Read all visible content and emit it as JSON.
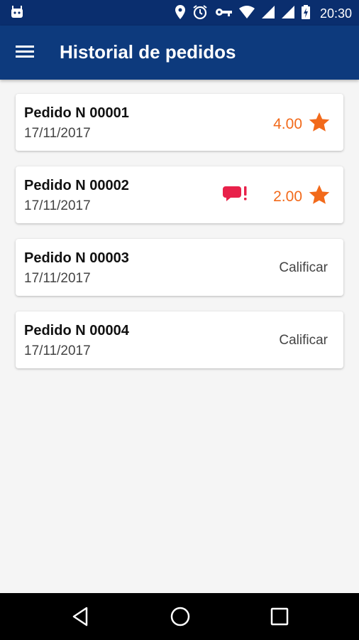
{
  "status_bar": {
    "time": "20:30",
    "icons": [
      "android-icon",
      "location-icon",
      "alarm-icon",
      "key-icon",
      "wifi-icon",
      "signal-icon",
      "signal-icon",
      "battery-charging-icon"
    ]
  },
  "app_bar": {
    "title": "Historial de pedidos",
    "menu_icon": "menu-icon"
  },
  "orders": [
    {
      "title": "Pedido N 00001",
      "date": "17/11/2017",
      "rating": "4.00",
      "has_alert": false
    },
    {
      "title": "Pedido N 00002",
      "date": "17/11/2017",
      "rating": "2.00",
      "has_alert": true
    },
    {
      "title": "Pedido N 00003",
      "date": "17/11/2017",
      "action": "Calificar"
    },
    {
      "title": "Pedido N 00004",
      "date": "17/11/2017",
      "action": "Calificar"
    }
  ],
  "colors": {
    "status_bar": "#0a2e6e",
    "app_bar": "#0d3a7d",
    "rating": "#f26a1b",
    "alert": "#e8214a"
  },
  "nav_bar": {
    "icons": [
      "back-icon",
      "home-icon",
      "recents-icon"
    ]
  }
}
